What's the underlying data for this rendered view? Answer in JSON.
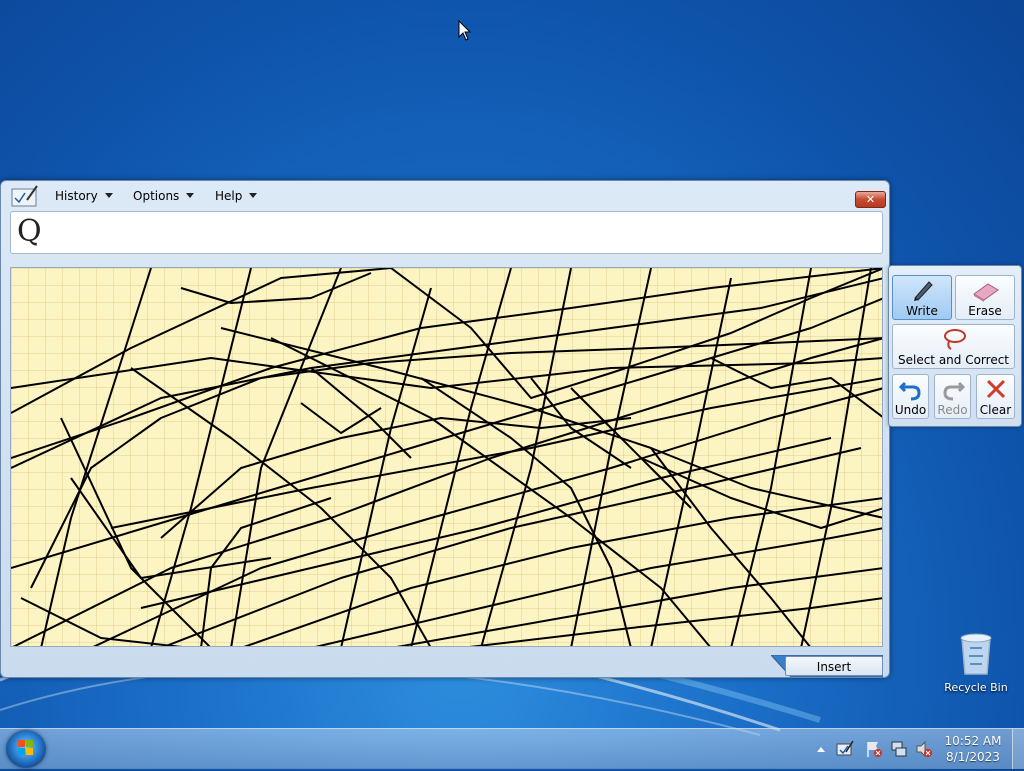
{
  "menus": {
    "history": "History",
    "options": "Options",
    "help": "Help"
  },
  "close_label": "✕",
  "preview_text": "Q",
  "insert_label": "Insert",
  "tools": {
    "write": "Write",
    "erase": "Erase",
    "select_correct": "Select and Correct",
    "undo": "Undo",
    "redo": "Redo",
    "clear": "Clear"
  },
  "desktop": {
    "recycle_bin": "Recycle Bin"
  },
  "clock": {
    "time": "10:52 AM",
    "date": "8/1/2023"
  },
  "colors": {
    "pad_bg": "#fdf4c4",
    "ink": "#000000",
    "accent": "#1b6fc8"
  }
}
